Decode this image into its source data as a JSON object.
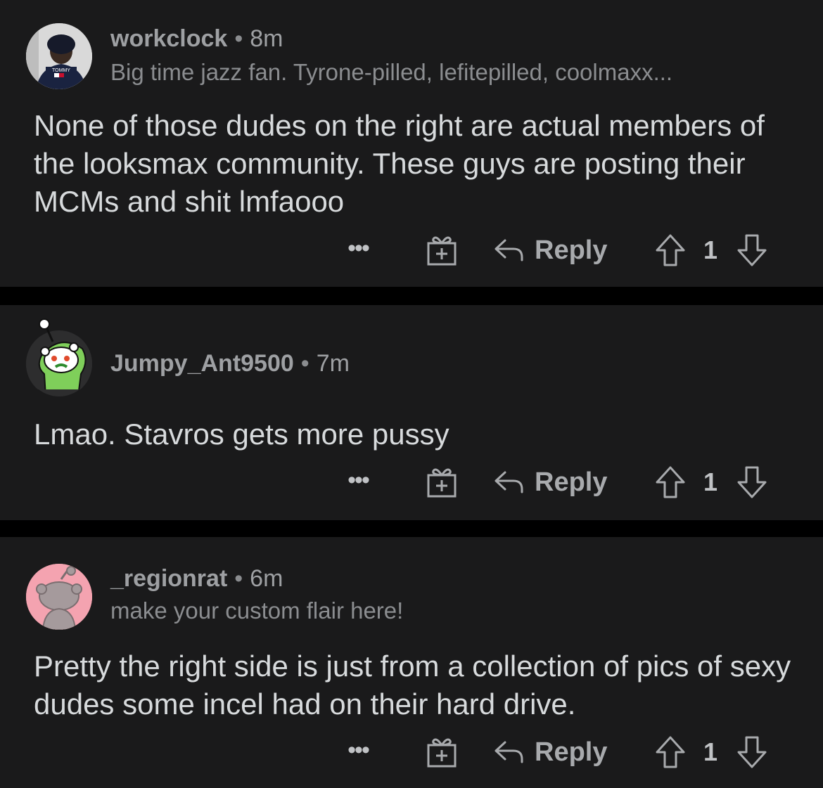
{
  "comments": [
    {
      "username": "workclock",
      "separator": "•",
      "time": "8m",
      "flair": "Big time jazz fan. Tyrone-pilled, lefitepilled, coolmaxx...",
      "body": "None of those dudes on the right are actual members of the looksmax community. These guys are posting their MCMs and shit lmfaooo",
      "reply_label": "Reply",
      "score": "1",
      "avatar_text": "TOMMY",
      "more_label": "•••"
    },
    {
      "username": "Jumpy_Ant9500",
      "separator": "•",
      "time": "7m",
      "body": "Lmao. Stavros gets more pussy",
      "reply_label": "Reply",
      "score": "1",
      "more_label": "•••"
    },
    {
      "username": "_regionrat",
      "separator": "•",
      "time": "6m",
      "flair": "make your custom flair here!",
      "body": "Pretty the right side is just from a collection of pics of sexy dudes some incel had on their hard drive.",
      "reply_label": "Reply",
      "score": "1",
      "more_label": "•••"
    }
  ],
  "colors": {
    "background": "#000000",
    "card": "#1a1a1b",
    "text": "#d7dadc",
    "meta": "#9ea0a3"
  },
  "icons": [
    "more-icon",
    "gift-icon",
    "reply-arrow-icon",
    "upvote-icon",
    "downvote-icon"
  ]
}
